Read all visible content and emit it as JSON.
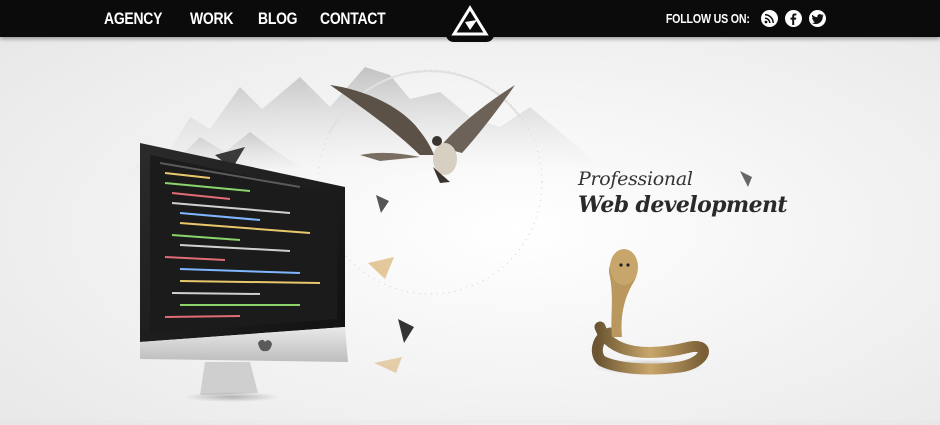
{
  "nav": {
    "items": [
      {
        "label": "AGENCY"
      },
      {
        "label": "WORK"
      },
      {
        "label": "BLOG"
      },
      {
        "label": "CONTACT"
      }
    ]
  },
  "social": {
    "label": "FOLLOW US ON:",
    "icons": [
      "rss-icon",
      "facebook-icon",
      "twitter-icon"
    ]
  },
  "hero": {
    "line1": "Professional",
    "line2": "Web development"
  },
  "colors": {
    "bar": "#0b0b0b",
    "background": "#efefef",
    "text": "#2a2a2a"
  }
}
